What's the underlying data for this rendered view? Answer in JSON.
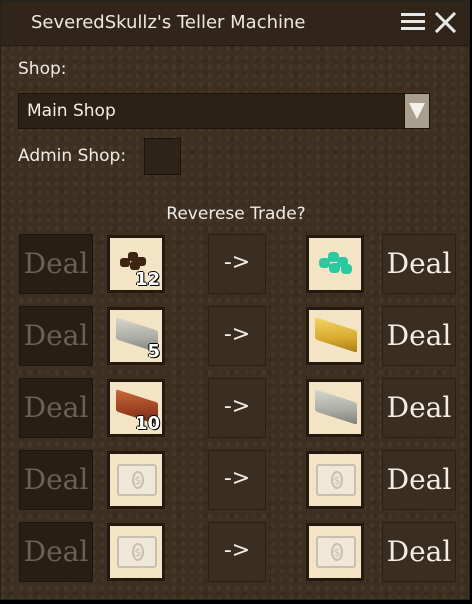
{
  "window": {
    "title": "SeveredSkullz's Teller Machine",
    "menu_icon": "hamburger-icon",
    "close_icon": "close-icon"
  },
  "shop": {
    "label": "Shop:",
    "selected": "Main Shop"
  },
  "admin": {
    "label": "Admin Shop:",
    "checked": false
  },
  "reverse_trade_label": "Reverese Trade?",
  "trades": [
    {
      "left_deal": "Deal",
      "left_enabled": false,
      "input_item": "coal",
      "input_count": "12",
      "arrow": "->",
      "output_item": "emerald",
      "output_count": "",
      "right_deal": "Deal",
      "right_enabled": true
    },
    {
      "left_deal": "Deal",
      "left_enabled": false,
      "input_item": "iron-ingot",
      "input_count": "5",
      "arrow": "->",
      "output_item": "gold-ingot",
      "output_count": "",
      "right_deal": "Deal",
      "right_enabled": true
    },
    {
      "left_deal": "Deal",
      "left_enabled": false,
      "input_item": "brick",
      "input_count": "10",
      "arrow": "->",
      "output_item": "iron-ingot",
      "output_count": "",
      "right_deal": "Deal",
      "right_enabled": true
    },
    {
      "left_deal": "Deal",
      "left_enabled": false,
      "input_item": "banknote",
      "input_count": "",
      "arrow": "->",
      "output_item": "banknote",
      "output_count": "",
      "right_deal": "Deal",
      "right_enabled": true
    },
    {
      "left_deal": "Deal",
      "left_enabled": false,
      "input_item": "banknote",
      "input_count": "",
      "arrow": "->",
      "output_item": "banknote",
      "output_count": "",
      "right_deal": "Deal",
      "right_enabled": true
    }
  ]
}
